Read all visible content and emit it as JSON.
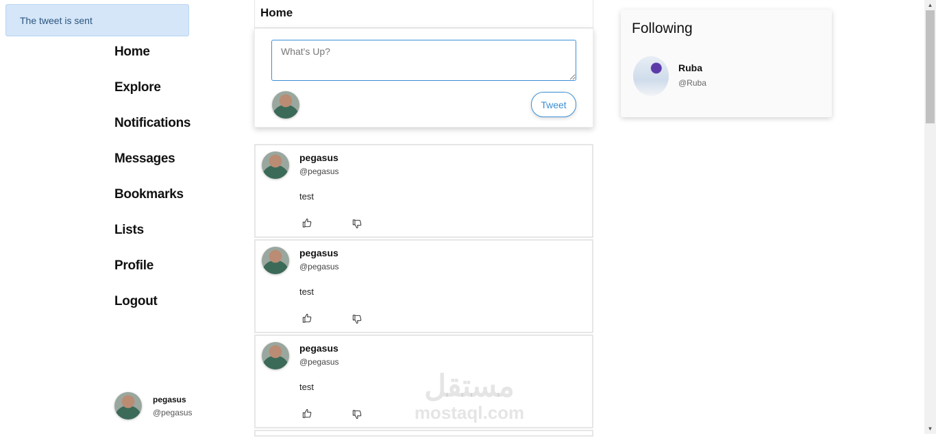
{
  "alert": {
    "text": "The tweet is sent"
  },
  "nav": {
    "items": [
      {
        "label": "Home"
      },
      {
        "label": "Explore"
      },
      {
        "label": "Notifications"
      },
      {
        "label": "Messages"
      },
      {
        "label": "Bookmarks"
      },
      {
        "label": "Lists"
      },
      {
        "label": "Profile"
      },
      {
        "label": "Logout"
      }
    ]
  },
  "current_user": {
    "name": "pegasus",
    "handle": "@pegasus"
  },
  "header": {
    "title": "Home"
  },
  "composer": {
    "placeholder": "What's Up?",
    "value": "",
    "tweet_label": "Tweet"
  },
  "feed": {
    "tweets": [
      {
        "name": "pegasus",
        "handle": "@pegasus",
        "text": "test"
      },
      {
        "name": "pegasus",
        "handle": "@pegasus",
        "text": "test"
      },
      {
        "name": "pegasus",
        "handle": "@pegasus",
        "text": "test"
      }
    ]
  },
  "following": {
    "title": "Following",
    "users": [
      {
        "name": "Ruba",
        "handle": "@Ruba"
      }
    ]
  },
  "watermark": {
    "arabic": "مستقل",
    "latin": "mostaql.com"
  },
  "icons": {
    "like": "thumbs-up-icon",
    "dislike": "thumbs-down-icon"
  }
}
